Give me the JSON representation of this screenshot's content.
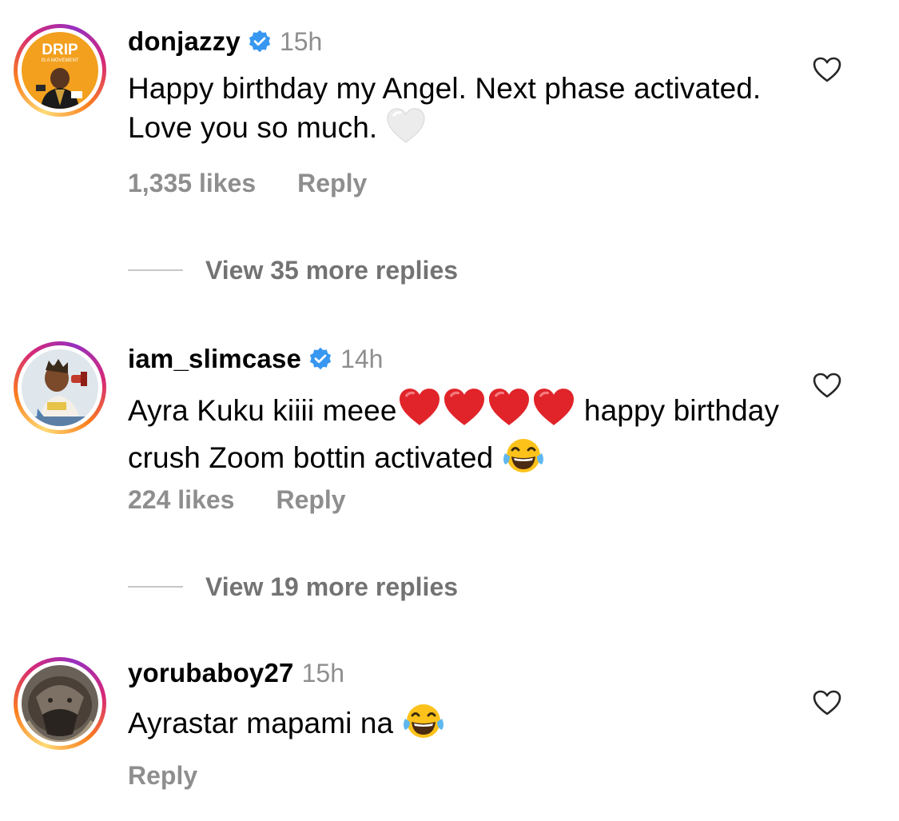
{
  "comments": [
    {
      "username": "donjazzy",
      "verified": true,
      "time": "15h",
      "text": "Happy birthday my Angel. Next phase activated. Love you so much.",
      "text_emoji": "white-heart",
      "likes": "1,335 likes",
      "reply_label": "Reply",
      "view_replies": "View 35 more replies",
      "avatar_label_line1": "DRIP",
      "avatar_label_line2": "IS A MOVEMENT"
    },
    {
      "username": "iam_slimcase",
      "verified": true,
      "time": "14h",
      "text_before": "Ayra Kuku kiiii meee",
      "text_emoji_hearts": [
        "red-heart",
        "red-heart",
        "red-heart",
        "red-heart"
      ],
      "text_after": " happy birthday crush Zoom bottin activated ",
      "text_end_emoji": "face-with-tears-of-joy",
      "likes": "224 likes",
      "reply_label": "Reply",
      "view_replies": "View 19 more replies"
    },
    {
      "username": "yorubaboy27",
      "verified": false,
      "time": "15h",
      "text": "Ayrastar mapami na ",
      "text_end_emoji": "face-with-tears-of-joy",
      "reply_label": "Reply"
    }
  ],
  "icons": {
    "verified": "verified-badge-icon",
    "like": "heart-outline-icon"
  },
  "colors": {
    "verified_blue": "#3897f0",
    "meta_gray": "#8e8e8e",
    "view_replies_gray": "#737373",
    "red_heart": "#e0242a",
    "white_heart": "#e8e8e8"
  }
}
